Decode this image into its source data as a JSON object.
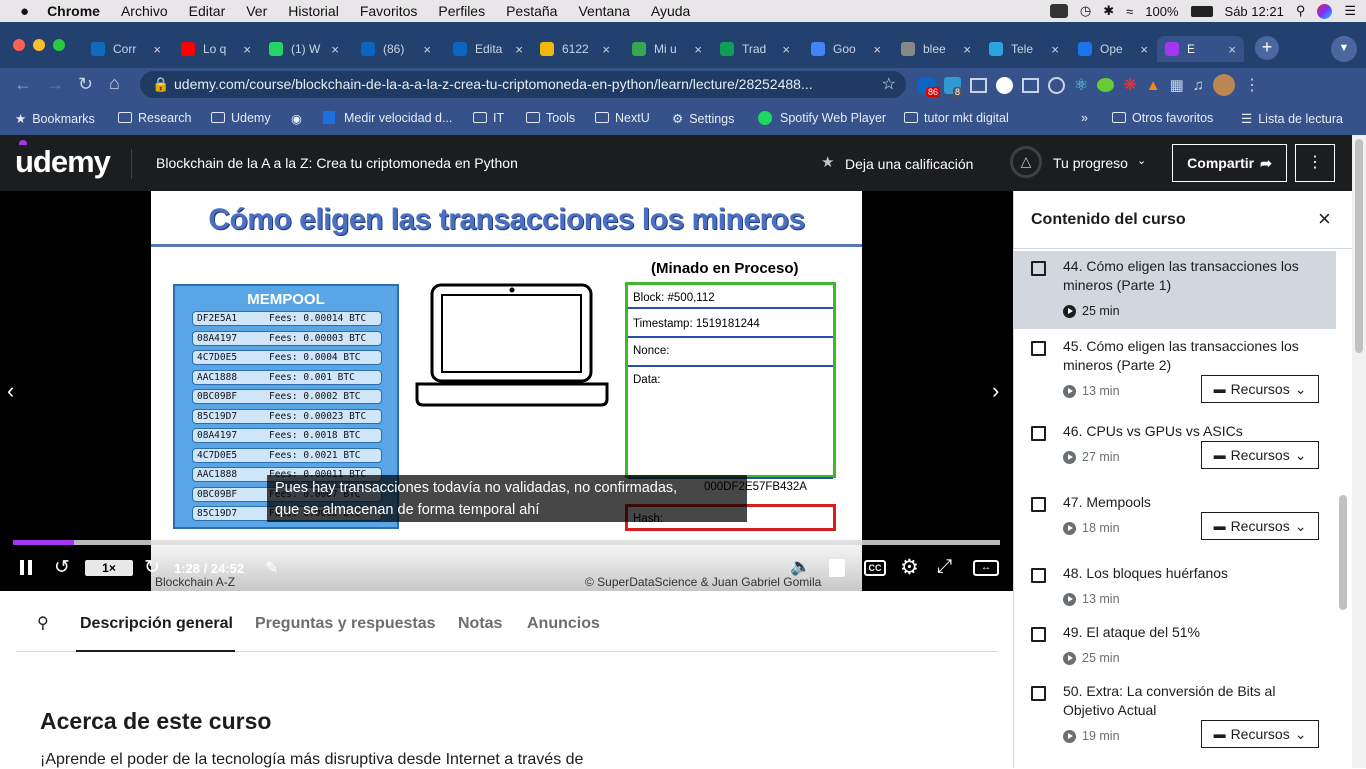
{
  "macos": {
    "apple": "",
    "menu": [
      "Chrome",
      "Archivo",
      "Editar",
      "Ver",
      "Historial",
      "Favoritos",
      "Perfiles",
      "Pestaña",
      "Ventana",
      "Ayuda"
    ],
    "battery": "100%",
    "clock": "Sáb 12:21"
  },
  "tabs": [
    {
      "label": "Corr",
      "color": "#0f6cbd"
    },
    {
      "label": "Lo q",
      "color": "#ff0000"
    },
    {
      "label": "(1) W",
      "color": "#25d366"
    },
    {
      "label": "(86)",
      "color": "#0a66c2"
    },
    {
      "label": "Edita",
      "color": "#0a66c2"
    },
    {
      "label": "6122",
      "color": "#f0b90b"
    },
    {
      "label": "Mi u",
      "color": "#34a853"
    },
    {
      "label": "Trad",
      "color": "#0f9d58"
    },
    {
      "label": "Goo",
      "color": "#4285f4"
    },
    {
      "label": "blee",
      "color": "#888888"
    },
    {
      "label": "Tele",
      "color": "#2aa3de"
    },
    {
      "label": "Ope",
      "color": "#1a73e8"
    },
    {
      "label": "E",
      "color": "#a435f0"
    }
  ],
  "url": "udemy.com/course/blockchain-de-la-a-a-la-z-crea-tu-criptomoneda-en-python/learn/lecture/28252488...",
  "ext_badges": {
    "a": "86",
    "b": "8"
  },
  "bookmarks": {
    "items": [
      "Bookmarks",
      "Research",
      "Udemy",
      "",
      "Medir velocidad d...",
      "IT",
      "Tools",
      "NextU",
      "Settings",
      "Spotify Web Player",
      "tutor mkt digital"
    ],
    "overflow": "»",
    "others": "Otros favoritos",
    "reading": "Lista de lectura"
  },
  "udemy": {
    "logo": "udemy",
    "course_title": "Blockchain de la A a la Z: Crea tu criptomoneda en Python",
    "rate": "Deja una calificación",
    "progress": "Tu progreso",
    "share": "Compartir"
  },
  "slide": {
    "title": "Cómo eligen las transacciones los mineros",
    "mempool_title": "MEMPOOL",
    "transactions": [
      {
        "id": "DF2E5A1",
        "fee": "Fees: 0.00014 BTC"
      },
      {
        "id": "08A4197",
        "fee": "Fees: 0.00003 BTC"
      },
      {
        "id": "4C7D0E5",
        "fee": "Fees: 0.0004 BTC"
      },
      {
        "id": "AAC1888",
        "fee": "Fees: 0.001 BTC"
      },
      {
        "id": "0BC09BF",
        "fee": "Fees: 0.0002 BTC"
      },
      {
        "id": "85C19D7",
        "fee": "Fees: 0.00023 BTC"
      },
      {
        "id": "08A4197",
        "fee": "Fees: 0.0018 BTC"
      },
      {
        "id": "4C7D0E5",
        "fee": "Fees: 0.0021 BTC"
      },
      {
        "id": "AAC1888",
        "fee": "Fees: 0.00011 BTC"
      },
      {
        "id": "0BC09BF",
        "fee": "Fees: 0.0007 BTC"
      },
      {
        "id": "85C19D7",
        "fee": "Fees: 0.0002 BTC"
      }
    ],
    "mining_title": "(Minado en Proceso)",
    "block": "Block: #500,112",
    "timestamp": "Timestamp: 1519181244",
    "nonce": "Nonce:",
    "data": "Data:",
    "prev_hash": "000DF2E57FB432A",
    "hash": "Hash:",
    "footer_left": "Blockchain A-Z",
    "footer_right": "© SuperDataScience & Juan Gabriel Gomila"
  },
  "subtitle": {
    "line1": "Pues hay transacciones todavía no validadas, no confirmadas,",
    "line2": "que se almacenan de forma temporal ahí"
  },
  "player": {
    "speed": "1×",
    "time": "1:28 / 24:52",
    "progress": 0.062,
    "cc": "CC"
  },
  "tabs_below": {
    "items": [
      "Descripción general",
      "Preguntas y respuestas",
      "Notas",
      "Anuncios"
    ],
    "active": 0
  },
  "about": {
    "heading": "Acerca de este curso",
    "text": "¡Aprende el poder de la tecnología más disruptiva desde Internet a través de"
  },
  "sidebar": {
    "title": "Contenido del curso",
    "resources_label": "Recursos",
    "lessons": [
      {
        "title": "44. Cómo eligen las transacciones los mineros (Parte 1)",
        "duration": "25 min",
        "resources": false,
        "current": true
      },
      {
        "title": "45. Cómo eligen las transacciones los mineros (Parte 2)",
        "duration": "13 min",
        "resources": true,
        "current": false
      },
      {
        "title": "46. CPUs vs GPUs vs ASICs",
        "duration": "27 min",
        "resources": true,
        "current": false
      },
      {
        "title": "47. Mempools",
        "duration": "18 min",
        "resources": true,
        "current": false
      },
      {
        "title": "48. Los bloques huérfanos",
        "duration": "13 min",
        "resources": false,
        "current": false
      },
      {
        "title": "49. El ataque del 51%",
        "duration": "25 min",
        "resources": false,
        "current": false
      },
      {
        "title": "50. Extra: La conversión de Bits al Objetivo Actual",
        "duration": "19 min",
        "resources": true,
        "current": false
      }
    ]
  }
}
